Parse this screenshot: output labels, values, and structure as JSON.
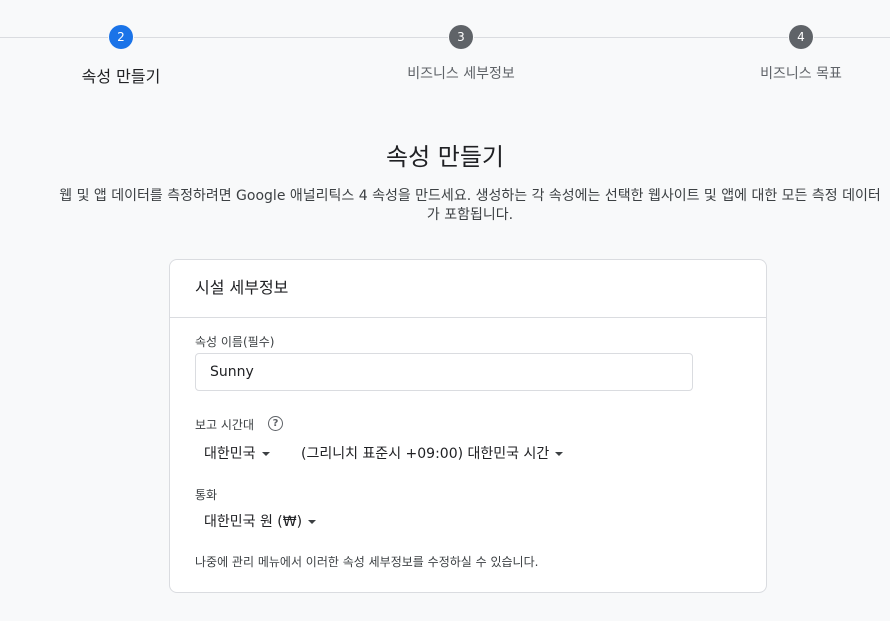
{
  "stepper": {
    "steps": [
      {
        "number": "2",
        "label": "속성 만들기"
      },
      {
        "number": "3",
        "label": "비즈니스 세부정보"
      },
      {
        "number": "4",
        "label": "비즈니스 목표"
      }
    ]
  },
  "header": {
    "title": "속성 만들기",
    "description": "웹 및 앱 데이터를 측정하려면 Google 애널리틱스 4 속성을 만드세요. 생성하는 각 속성에는 선택한 웹사이트 및 앱에 대한 모든 측정 데이터가 포함됩니다."
  },
  "card": {
    "title": "시설 세부정보",
    "property_name_label": "속성 이름(필수)",
    "property_name_value": "Sunny",
    "timezone_label": "보고 시간대",
    "help_icon_glyph": "?",
    "timezone_country": "대한민국",
    "timezone_value": "(그리니치 표준시 +09:00) 대한민국 시간",
    "currency_label": "통화",
    "currency_value": "대한민국 원 (₩)",
    "footer_note": "나중에 관리 메뉴에서 이러한 속성 세부정보를 수정하실 수 있습니다."
  },
  "colors": {
    "active_step": "#1a73e8",
    "inactive_step": "#5f6368",
    "background": "#f8f9fa"
  }
}
